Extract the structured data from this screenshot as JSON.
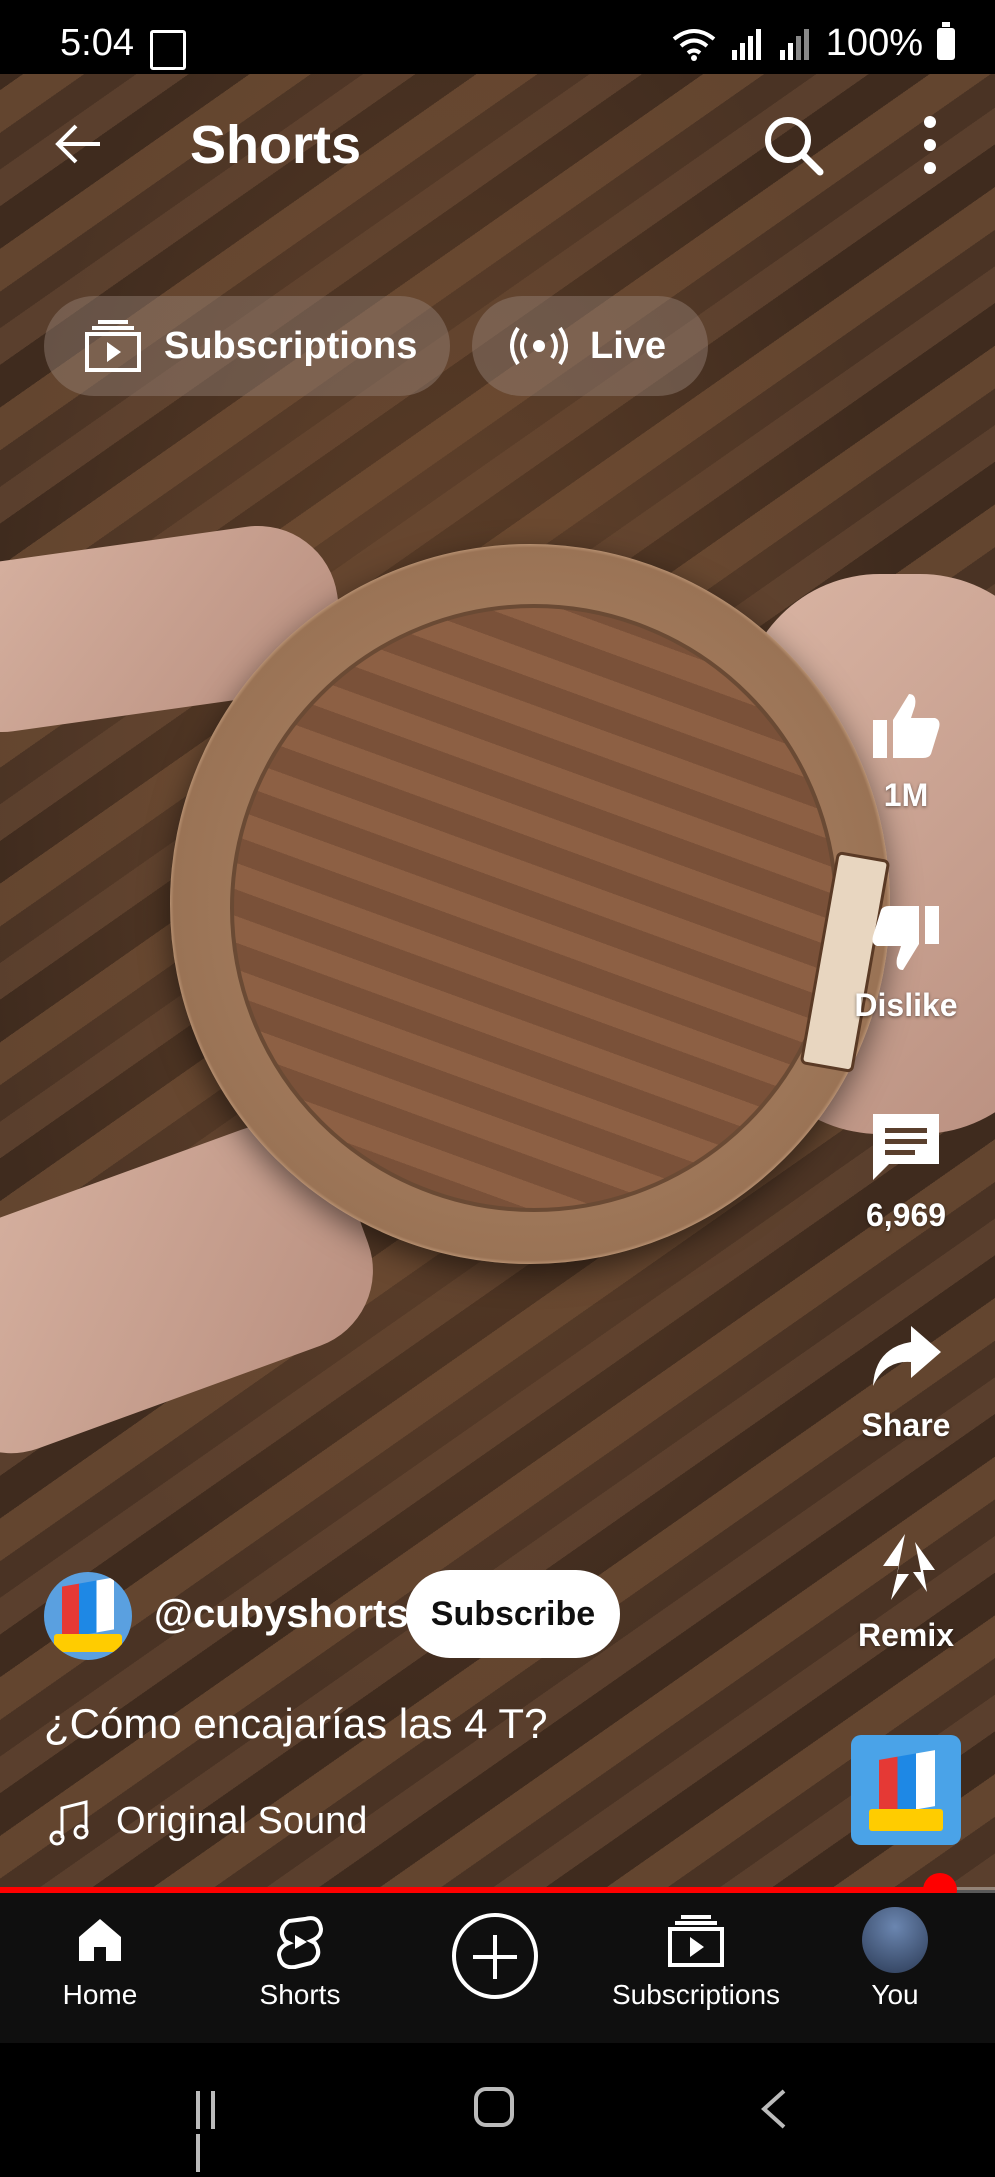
{
  "status_bar": {
    "time": "5:04",
    "battery": "100%"
  },
  "header": {
    "title": "Shorts"
  },
  "chips": [
    {
      "label": "Subscriptions"
    },
    {
      "label": "Live"
    }
  ],
  "actions": {
    "like": "1M",
    "dislike": "Dislike",
    "comments": "6,969",
    "share": "Share",
    "remix": "Remix"
  },
  "video": {
    "channel": "@cubyshorts",
    "subscribe_label": "Subscribe",
    "caption": "¿Cómo encajarías las 4 T?",
    "sound": "Original Sound",
    "progress": 0.945
  },
  "bottom_nav": [
    {
      "label": "Home",
      "icon": "home-icon"
    },
    {
      "label": "Shorts",
      "icon": "shorts-icon"
    },
    {
      "label": "",
      "icon": "create-icon"
    },
    {
      "label": "Subscriptions",
      "icon": "subscriptions-icon"
    },
    {
      "label": "You",
      "icon": "avatar"
    }
  ],
  "colors": {
    "accent": "#ff0000",
    "nav_bg": "#0f0f0f"
  }
}
